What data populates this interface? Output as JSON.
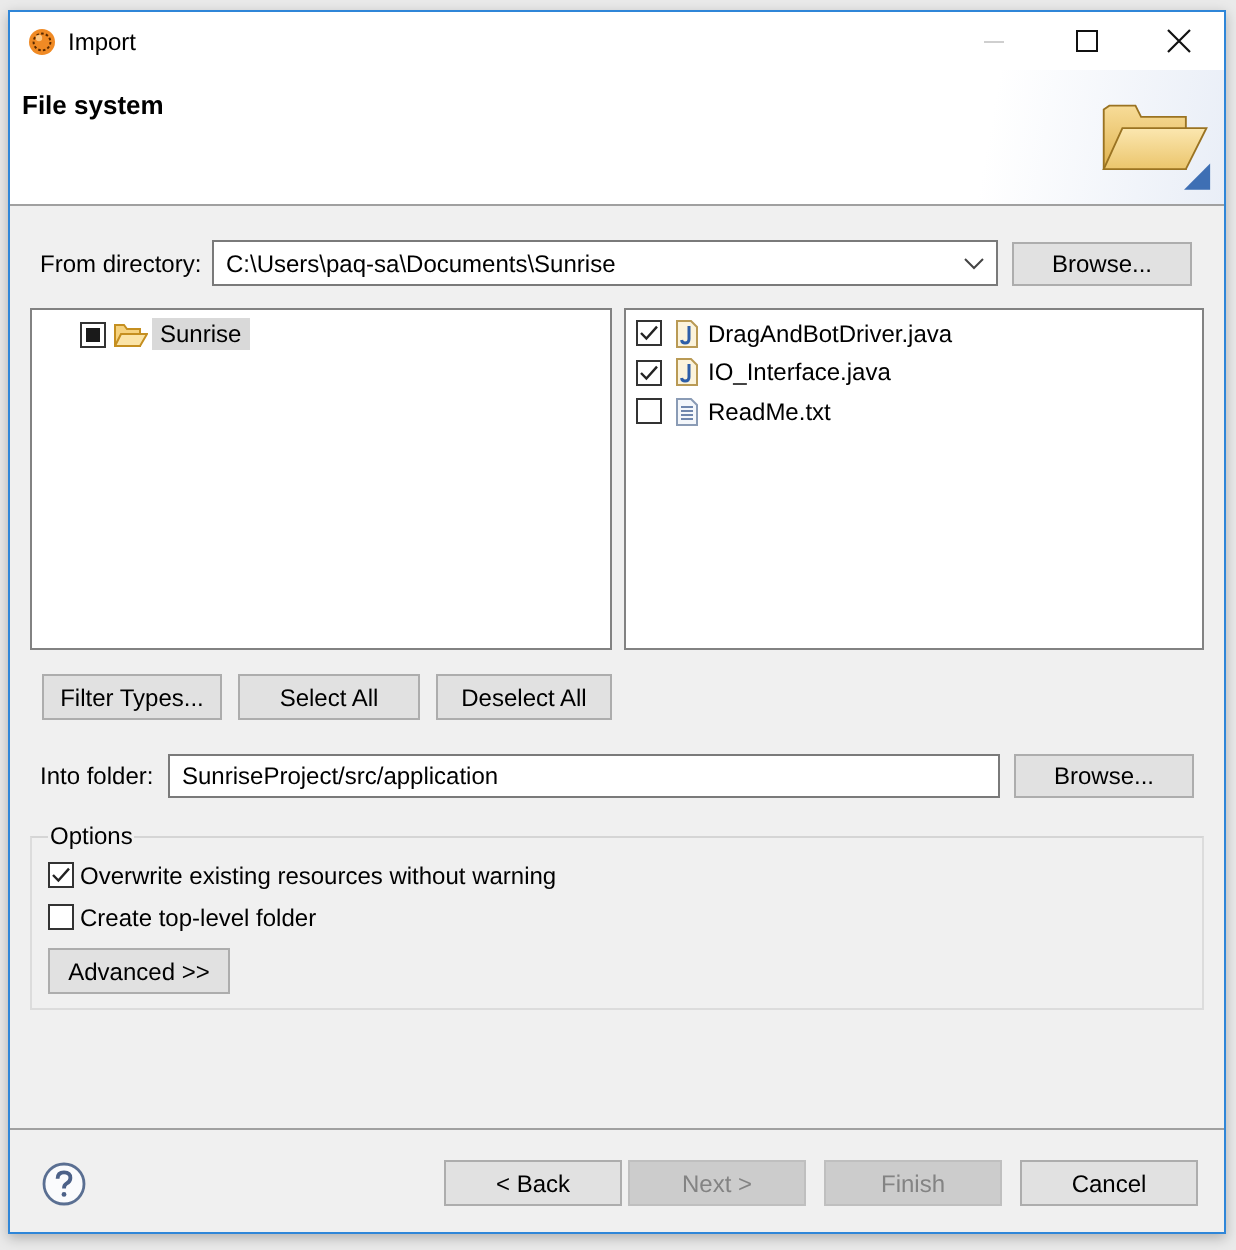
{
  "window": {
    "title": "Import"
  },
  "header": {
    "title": "File system"
  },
  "source": {
    "label": "From directory:",
    "value": "C:\\Users\\paq-sa\\Documents\\Sunrise",
    "button": "Browse..."
  },
  "tree": [
    {
      "label": "Sunrise",
      "checked": true,
      "partial": true,
      "selected": true
    }
  ],
  "files": [
    {
      "name": "DragAndBotDriver.java",
      "kind": "java",
      "checked": true
    },
    {
      "name": "IO_Interface.java",
      "kind": "java",
      "checked": true
    },
    {
      "name": "ReadMe.txt",
      "kind": "text",
      "checked": false
    }
  ],
  "selection_buttons": [
    {
      "label": "Filter Types..."
    },
    {
      "label": "Select All"
    },
    {
      "label": "Deselect All"
    }
  ],
  "destination": {
    "label": "Into folder:",
    "value": "SunriseProject/src/application",
    "button": "Browse..."
  },
  "options": {
    "title": "Options",
    "checkboxes": [
      {
        "label": "Overwrite existing resources without warning",
        "checked": true
      },
      {
        "label": "Create top-level folder",
        "checked": false
      }
    ],
    "button": "Advanced >>"
  },
  "footer_buttons": [
    {
      "label": "< Back",
      "disabled": false
    },
    {
      "label": "Next >",
      "disabled": true
    },
    {
      "label": "Finish",
      "disabled": true
    },
    {
      "label": "Cancel",
      "disabled": false
    }
  ]
}
